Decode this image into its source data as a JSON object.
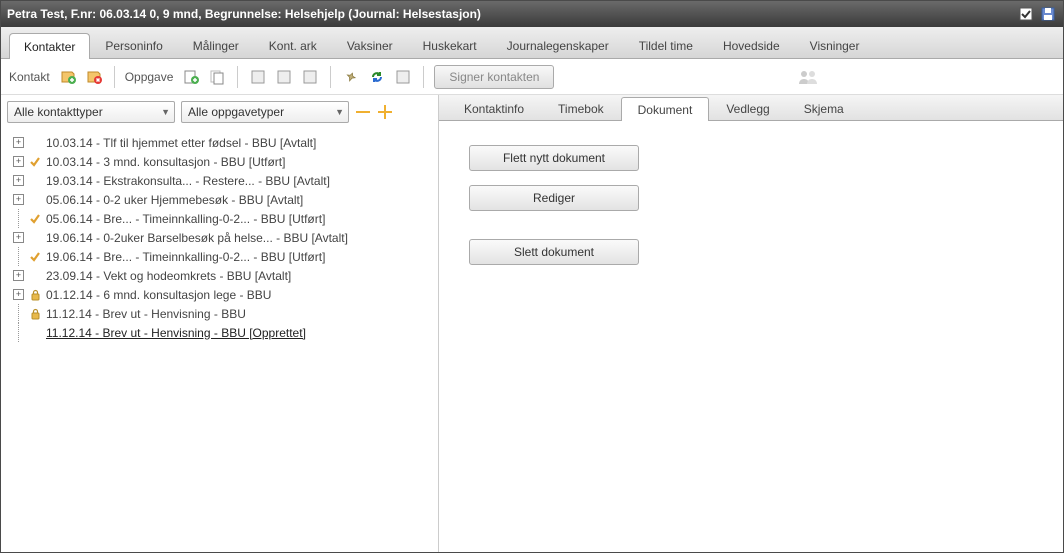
{
  "title": "Petra Test, F.nr: 06.03.14 0, 9 mnd, Begrunnelse: Helsehjelp (Journal: Helsestasjon)",
  "mainTabs": [
    "Kontakter",
    "Personinfo",
    "Målinger",
    "Kont. ark",
    "Vaksiner",
    "Huskekart",
    "Journalegenskaper",
    "Tildel time",
    "Hovedside",
    "Visninger"
  ],
  "mainActive": 0,
  "toolbar": {
    "kontakt": "Kontakt",
    "oppgave": "Oppgave",
    "signBtn": "Signer kontakten"
  },
  "filters": {
    "kontaktType": "Alle kontakttyper",
    "oppgaveType": "Alle oppgavetyper"
  },
  "tree": [
    {
      "exp": "+",
      "indent": 0,
      "mark": "",
      "text": "10.03.14 - Tlf til hjemmet etter fødsel - BBU [Avtalt]"
    },
    {
      "exp": "+",
      "indent": 0,
      "mark": "check",
      "text": "10.03.14 - 3 mnd. konsultasjon - BBU [Utført]"
    },
    {
      "exp": "+",
      "indent": 0,
      "mark": "",
      "text": "19.03.14 - Ekstrakonsulta... - Restere... - BBU [Avtalt]"
    },
    {
      "exp": "+",
      "indent": 0,
      "mark": "",
      "text": "05.06.14 - 0-2 uker Hjemmebesøk - BBU [Avtalt]"
    },
    {
      "exp": "",
      "indent": 1,
      "mark": "check",
      "text": "05.06.14 - Bre... - Timeinnkalling-0-2... - BBU [Utført]"
    },
    {
      "exp": "+",
      "indent": 0,
      "mark": "",
      "text": "19.06.14 - 0-2uker Barselbesøk på helse... - BBU [Avtalt]"
    },
    {
      "exp": "",
      "indent": 1,
      "mark": "check",
      "text": "19.06.14 - Bre... - Timeinnkalling-0-2... - BBU [Utført]"
    },
    {
      "exp": "+",
      "indent": 0,
      "mark": "",
      "text": "23.09.14 - Vekt og hodeomkrets - BBU [Avtalt]"
    },
    {
      "exp": "+",
      "indent": 0,
      "mark": "lock",
      "text": "01.12.14 - 6 mnd. konsultasjon lege - BBU"
    },
    {
      "exp": "",
      "indent": 1,
      "mark": "lock",
      "text": "11.12.14 - Brev ut - Henvisning - BBU"
    },
    {
      "exp": "",
      "indent": 1,
      "mark": "",
      "text": "11.12.14 - Brev ut - Henvisning - BBU [Opprettet]",
      "selected": true
    }
  ],
  "subTabs": [
    "Kontaktinfo",
    "Timebok",
    "Dokument",
    "Vedlegg",
    "Skjema"
  ],
  "subActive": 2,
  "paneButtons": {
    "flett": "Flett nytt dokument",
    "rediger": "Rediger",
    "slett": "Slett dokument"
  }
}
